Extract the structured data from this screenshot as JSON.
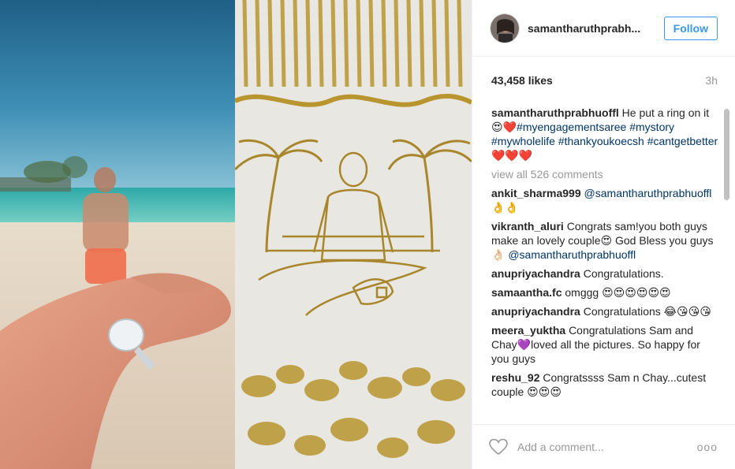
{
  "header": {
    "username": "samantharuthprabh...",
    "follow_label": "Follow"
  },
  "meta": {
    "likes": "43,458 likes",
    "time": "3h"
  },
  "caption": {
    "username": "samantharuthprabhuoffl",
    "text": "He put a ring on it",
    "emoji": "😍❤️",
    "hashtags": [
      "#myengagementsaree",
      "#mystory",
      "#mywholelife",
      "#thankyoukoecsh",
      "#cantgetbetter"
    ],
    "trailing_emoji": "❤️❤️❤️"
  },
  "view_all_label": "view all 526 comments",
  "comments": [
    {
      "user": "ankit_sharma999",
      "mention": "@samantharuthprabhuoffl",
      "text": "",
      "emoji": "👌👌"
    },
    {
      "user": "vikranth_aluri",
      "text": "Congrats sam!you both guys make an lovely couple😍 God Bless you guys👌🏻",
      "mention": "@samantharuthprabhuoffl"
    },
    {
      "user": "anupriyachandra",
      "text": "Congratulations."
    },
    {
      "user": "samaantha.fc",
      "text": "omggg 😍😍😍😍😍😍"
    },
    {
      "user": "anupriyachandra",
      "text": "Congratulations 😂😘😘😘"
    },
    {
      "user": "meera_yuktha",
      "text": "Congratulations Sam and Chay💜loved all the pictures. So happy for you guys"
    },
    {
      "user": "reshu_92",
      "text": "Congratssss Sam n Chay...cutest couple 😍😍😍"
    }
  ],
  "footer": {
    "placeholder": "Add a comment...",
    "more_label": "ooo"
  }
}
